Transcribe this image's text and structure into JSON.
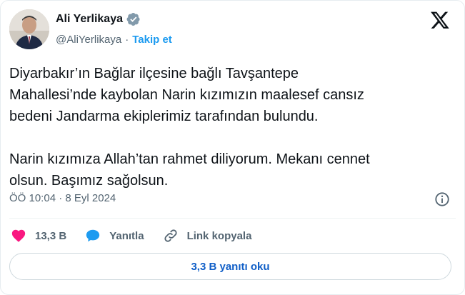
{
  "author": {
    "name": "Ali Yerlikaya",
    "handle": "@AliYerlikaya",
    "separator": "·",
    "follow_label": "Takip et"
  },
  "tweet": {
    "text": "Diyarbakır’ın Bağlar ilçesine bağlı Tavşantepe\nMahallesi’nde kaybolan Narin kızımızın maalesef cansız\nbedeni Jandarma ekiplerimiz tarafından bulundu.\n\nNarin kızımıza Allah’tan rahmet diliyorum. Mekanı cennet\nolsun. Başımız sağolsun.",
    "timestamp": "ÖÖ 10:04 · 8 Eyl 2024"
  },
  "actions": {
    "likes": "13,3 B",
    "reply_label": "Yanıtla",
    "copy_link_label": "Link kopyala"
  },
  "replies_button": "3,3 B yanıtı oku",
  "colors": {
    "accent": "#1d9bf0",
    "like": "#f91880",
    "text": "#0f1419",
    "muted": "#536471"
  },
  "icons": [
    "verified-badge-icon",
    "x-logo-icon",
    "info-icon",
    "heart-icon",
    "reply-icon",
    "link-icon"
  ]
}
